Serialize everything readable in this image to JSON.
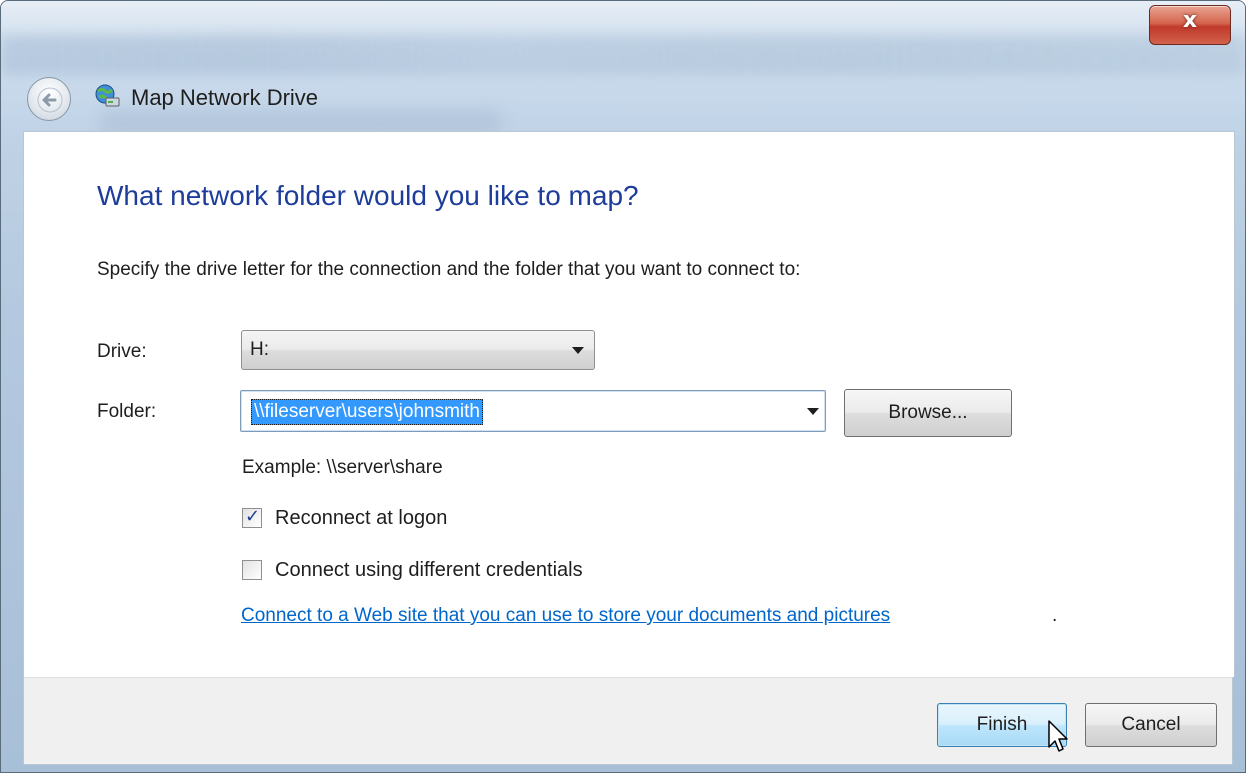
{
  "window": {
    "title": "Map Network Drive",
    "close_glyph": "x"
  },
  "page": {
    "heading": "What network folder would you like to map?",
    "instructions": "Specify the drive letter for the connection and the folder that you want to connect to:"
  },
  "form": {
    "drive_label": "Drive:",
    "drive_value": "H:",
    "folder_label": "Folder:",
    "folder_value": "\\\\fileserver\\users\\johnsmith",
    "browse_label": "Browse...",
    "example_text": "Example: \\\\server\\share",
    "reconnect_label": "Reconnect at logon",
    "reconnect_checked": true,
    "credentials_label": "Connect using different credentials",
    "credentials_checked": false,
    "web_link": "Connect to a Web site that you can use to store your documents and pictures",
    "web_link_suffix": "."
  },
  "footer": {
    "finish_label": "Finish",
    "cancel_label": "Cancel"
  },
  "icons": {
    "back": "back-arrow-icon",
    "title": "network-drive-icon",
    "close": "close-icon",
    "dropdown": "chevron-down-icon",
    "check": "checkmark-icon",
    "cursor": "mouse-pointer-icon"
  },
  "colors": {
    "heading": "#1e3d9a",
    "link": "#0066cc",
    "selection": "#3399ff",
    "close_button": "#c0392b"
  }
}
